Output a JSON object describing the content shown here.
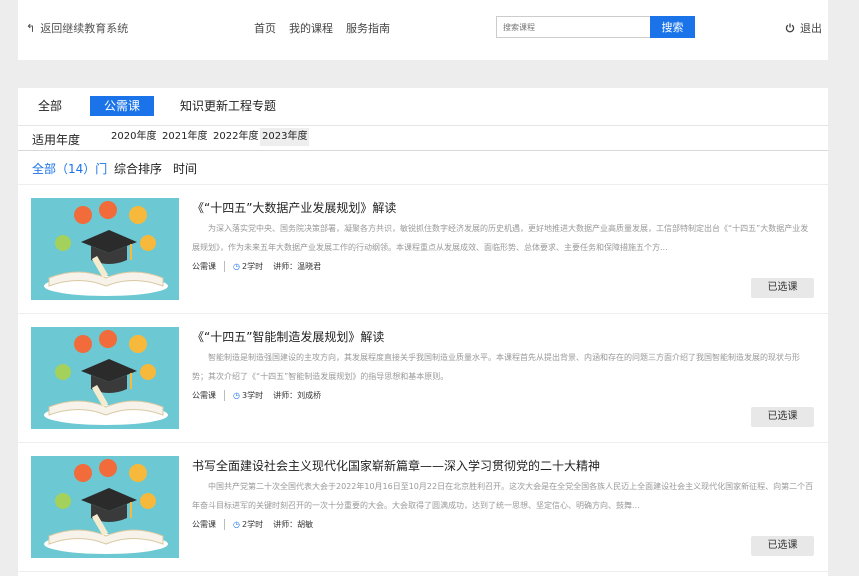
{
  "header": {
    "back_label": "返回继续教育系统",
    "nav": [
      "首页",
      "我的课程",
      "服务指南"
    ],
    "search_placeholder": "搜索课程",
    "search_button": "搜索",
    "logout": "退出"
  },
  "tabs": [
    "全部",
    "公需课",
    "知识更新工程专题"
  ],
  "years": {
    "label": "适用年度",
    "options": [
      "2020年度",
      "2021年度",
      "2022年度",
      "2023年度"
    ],
    "selected": "2023年度"
  },
  "sort": {
    "count_label": "全部（14）门",
    "sort_label": "综合排序",
    "time_label": "时间"
  },
  "courses": [
    {
      "title": "《“十四五”大数据产业发展规划》解读",
      "desc": "为深入落实党中央、国务院决策部署，凝聚各方共识，敏锐抓住数字经济发展的历史机遇，更好地推进大数据产业高质量发展，工信部特制定出台《“十四五”大数据产业发展规划》，作为未来五年大数据产业发展工作的行动纲领。本课程重点从发展成效、面临形势、总体要求、主要任务和保障措施五个方...",
      "type": "公需课",
      "hours": "2学时",
      "teacher": "讲师：温晓君",
      "status": "已选课"
    },
    {
      "title": "《“十四五”智能制造发展规划》解读",
      "desc": "智能制造是制造强国建设的主攻方向，其发展程度直接关乎我国制造业质量水平。本课程首先从提出背景、内涵和存在的问题三方面介绍了我国智能制造发展的现状与形势；其次介绍了《“十四五”智能制造发展规划》的指导思想和基本原则。",
      "type": "公需课",
      "hours": "3学时",
      "teacher": "讲师：刘成桥",
      "status": "已选课"
    },
    {
      "title": "书写全面建设社会主义现代化国家崭新篇章——深入学习贯彻党的二十大精神",
      "desc": "中国共产党第二十次全国代表大会于2022年10月16日至10月22日在北京胜利召开。这次大会是在全党全国各族人民迈上全面建设社会主义现代化国家新征程、向第二个百年奋斗目标进军的关键时刻召开的一次十分重要的大会。大会取得了圆满成功，达到了统一思想、坚定信心、明确方向、鼓舞...",
      "type": "公需课",
      "hours": "2学时",
      "teacher": "讲师：胡敏",
      "status": "已选课"
    }
  ],
  "colors": {
    "accent": "#1a73e8",
    "thumb_bg": "#6cc8d3"
  }
}
